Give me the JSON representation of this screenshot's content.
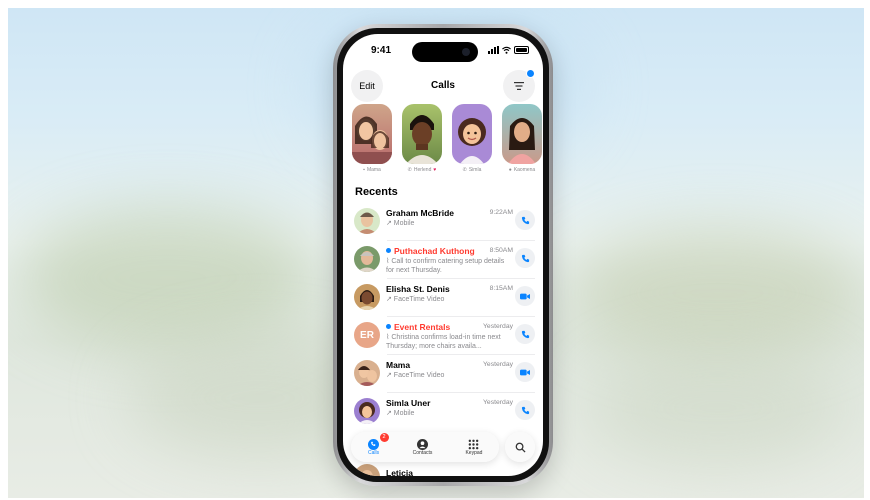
{
  "status_bar": {
    "time": "9:41"
  },
  "header": {
    "edit_label": "Edit",
    "title": "Calls",
    "filter_icon": "filter-lines-icon",
    "filter_badge_color": "#0a84ff"
  },
  "favorites": [
    {
      "name": "Mama",
      "icon": "video-icon"
    },
    {
      "name": "Herlend",
      "icon": "phone-icon",
      "suffix": "♥"
    },
    {
      "name": "Simla",
      "icon": "phone-icon"
    },
    {
      "name": "Kaomena",
      "icon": "message-icon"
    }
  ],
  "recents_title": "Recents",
  "recents": [
    {
      "name": "Graham McBride",
      "missed": false,
      "unread": false,
      "detail": "↗ Mobile",
      "time": "9:22AM",
      "action": "phone"
    },
    {
      "name": "Puthachad Kuthong",
      "missed": true,
      "unread": true,
      "detail": "Call to confirm catering setup details for next Thursday.",
      "time": "8:50AM",
      "action": "phone"
    },
    {
      "name": "Elisha St. Denis",
      "missed": false,
      "unread": false,
      "detail": "↗ FaceTime Video",
      "time": "8:15AM",
      "action": "video"
    },
    {
      "name": "Event Rentals",
      "missed": true,
      "unread": true,
      "detail": "Christina confirms load-in time next Thursday; more chairs availa...",
      "time": "Yesterday",
      "action": "phone",
      "initials": "ER"
    },
    {
      "name": "Mama",
      "missed": false,
      "unread": false,
      "detail": "↗ FaceTime Video",
      "time": "Yesterday",
      "action": "video"
    },
    {
      "name": "Simla Uner",
      "missed": false,
      "unread": false,
      "detail": "↗ Mobile",
      "time": "Yesterday",
      "action": "phone"
    }
  ],
  "peek_row": {
    "name": "Leticia"
  },
  "tabbar": {
    "tabs": [
      {
        "label": "Calls",
        "active": true,
        "badge": "2"
      },
      {
        "label": "Contacts",
        "active": false
      },
      {
        "label": "Keypad",
        "active": false
      }
    ]
  },
  "colors": {
    "accent": "#0a84ff",
    "missed": "#ff3b30"
  }
}
